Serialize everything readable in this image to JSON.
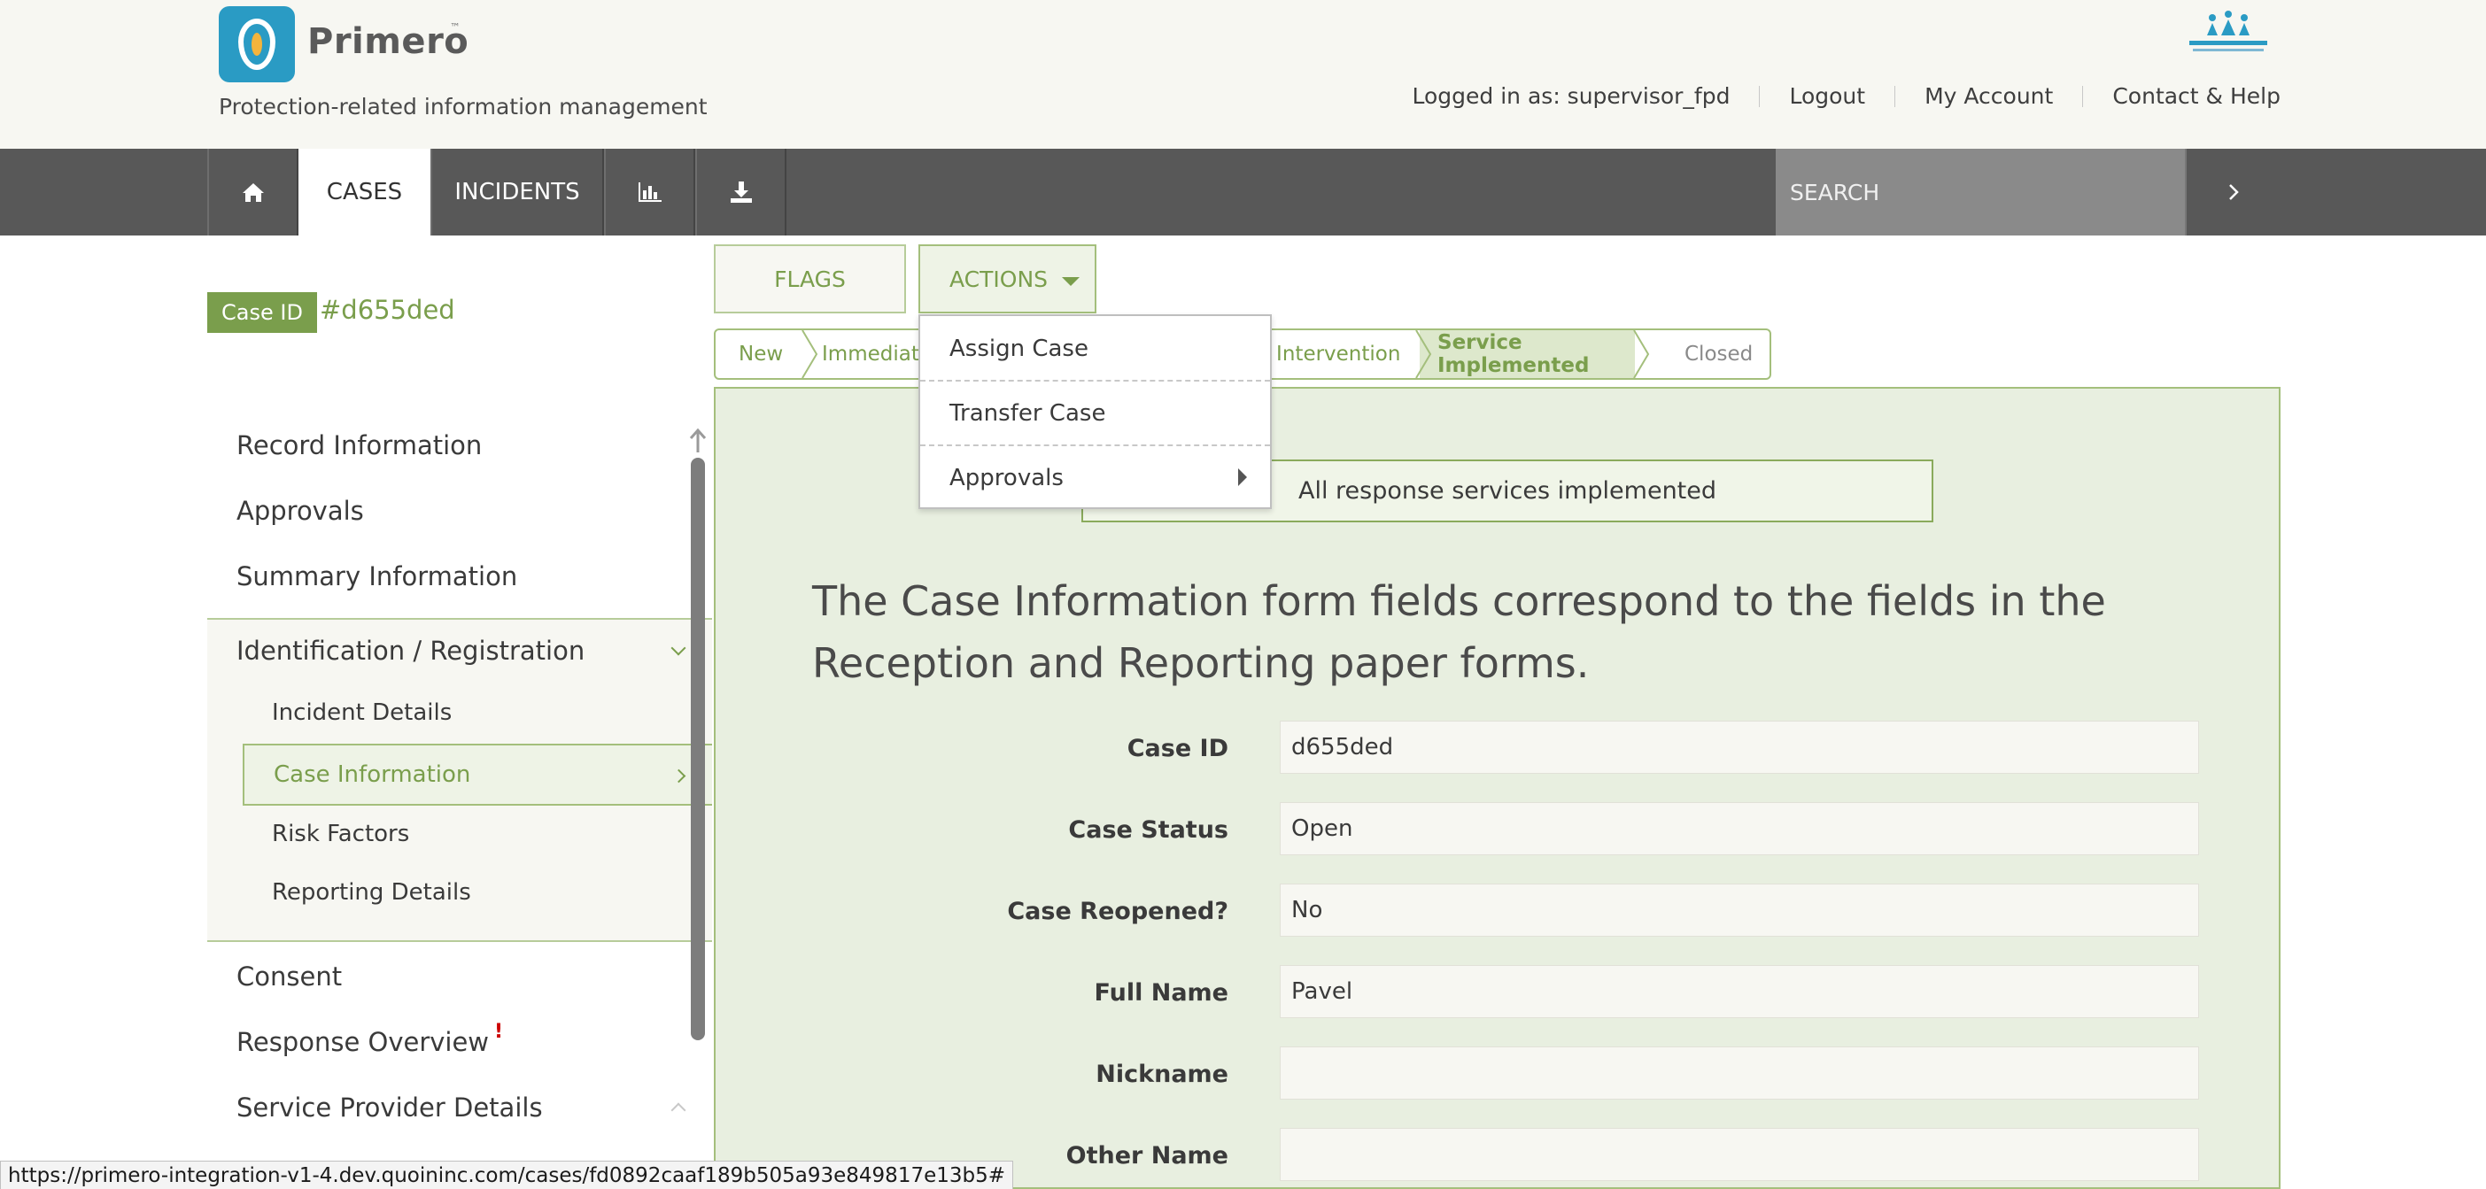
{
  "header": {
    "app_name": "Primero",
    "trademark": "™",
    "tagline": "Protection-related information management",
    "logged_in": "Logged in as: supervisor_fpd",
    "logout": "Logout",
    "my_account": "My Account",
    "contact": "Contact & Help"
  },
  "nav": {
    "home_icon": "home-icon",
    "cases": "CASES",
    "incidents": "INCIDENTS",
    "reports_icon": "bar-chart-icon",
    "export_icon": "download-icon",
    "search_placeholder": "SEARCH",
    "search_go_icon": "chevron-right-icon"
  },
  "case": {
    "id_label": "Case ID",
    "id_value": "#d655ded"
  },
  "toolbar": {
    "flags": "FLAGS",
    "actions": "ACTIONS"
  },
  "actions_menu": {
    "items": [
      "Assign Case",
      "Transfer Case",
      "Approvals"
    ]
  },
  "workflow": {
    "steps": [
      "New",
      "Immediate",
      "/ Intervention",
      "Service Implemented",
      "Closed"
    ],
    "current": "Service Implemented"
  },
  "sidebar": {
    "items": [
      "Record Information",
      "Approvals",
      "Summary Information",
      "Identification / Registration",
      "Incident Details",
      "Case Information",
      "Risk Factors",
      "Reporting Details",
      "Consent",
      "Response Overview",
      "Service Provider Details"
    ],
    "response_flag": "!"
  },
  "main": {
    "status_banner": "All response services implemented",
    "intro": "The Case Information form fields correspond to the fields in the Reception and Reporting paper forms.",
    "fields": [
      {
        "label": "Case ID",
        "value": "d655ded"
      },
      {
        "label": "Case Status",
        "value": "Open"
      },
      {
        "label": "Case Reopened?",
        "value": "No"
      },
      {
        "label": "Full Name",
        "value": "Pavel"
      },
      {
        "label": "Nickname",
        "value": ""
      },
      {
        "label": "Other Name",
        "value": ""
      }
    ]
  },
  "status_bar": {
    "url": "https://primero-integration-v1-4.dev.quoininc.com/cases/fd0892caaf189b505a93e849817e13b5#"
  },
  "colors": {
    "accent_green": "#7a9e4c",
    "nav_gray": "#585858",
    "panel_bg": "#e8efe0",
    "logo_blue": "#2a9bc4"
  }
}
